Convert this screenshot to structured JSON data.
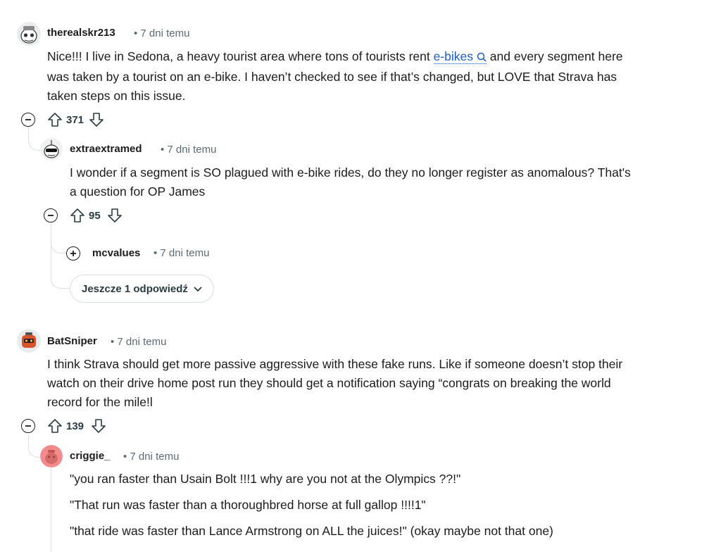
{
  "comments": [
    {
      "username": "therealskr213",
      "time": "• 7 dni temu",
      "text_before": "Nice!!! I live in Sedona, a heavy tourist area where tons of tourists rent ",
      "link_text": "e-bikes",
      "text_after_line1": " and every segment here",
      "line2": "was taken by a tourist on an e-bike. I haven’t checked to see if that’s changed, but LOVE that Strava has",
      "line3": "taken steps on this issue.",
      "votes": "371"
    },
    {
      "username": "extraextramed",
      "time": "• 7 dni temu",
      "line1": "I wonder if a segment is SO plagued with e-bike rides, do they no longer register as anomalous? That's",
      "line2": "a question for OP James",
      "votes": "95"
    },
    {
      "username": "mcvalues",
      "time": "• 7 dni temu"
    },
    {
      "username": "BatSniper",
      "time": "• 7 dni temu",
      "line1": "I think Strava should get more passive aggressive with these fake runs. Like if someone doesn’t stop their",
      "line2": "watch on their drive home post run they should get a notification saying “congrats on breaking the world",
      "line3": "record for the mile!l",
      "votes": "139"
    },
    {
      "username": "criggie_",
      "time": "• 7 dni temu",
      "p1": "\"you ran faster than Usain Bolt !!!1 why are you not at the Olympics ??!\"",
      "p2": "\"That run was faster than a thoroughbred horse at full gallop !!!!1\"",
      "p3": "\"that ride was faster than Lance Armstrong on ALL the juices!\" (okay maybe not that one)"
    }
  ],
  "more_replies_label": "Jeszcze 1 odpowiedź",
  "icons": {
    "collapse": "minus-circle-icon",
    "expand": "plus-circle-icon",
    "upvote": "arrow-up-icon",
    "downvote": "arrow-down-icon",
    "search": "search-icon",
    "chevron": "chevron-down-icon"
  }
}
